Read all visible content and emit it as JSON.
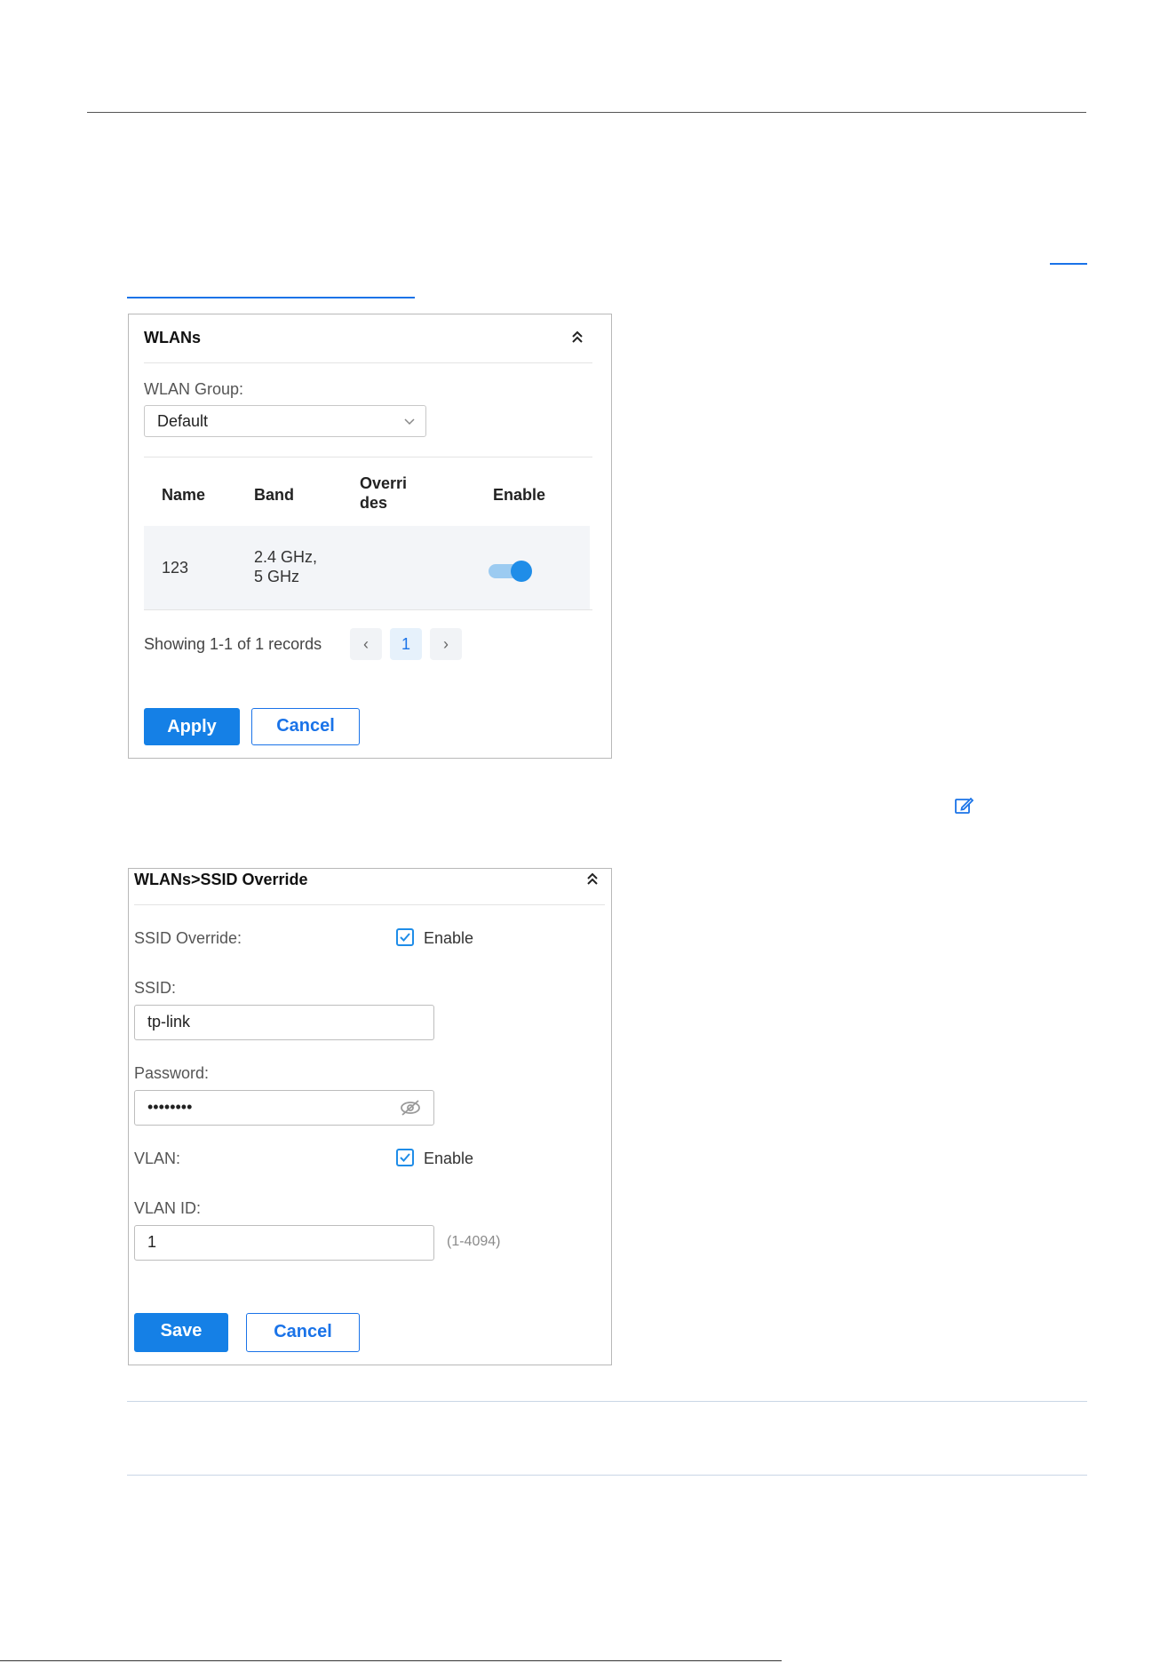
{
  "wlans_panel": {
    "title": "WLANs",
    "group_label": "WLAN Group:",
    "group_value": "Default",
    "columns": {
      "name": "Name",
      "band": "Band",
      "overrides_line1": "Overri",
      "overrides_line2": "des",
      "enable": "Enable"
    },
    "row": {
      "name": "123",
      "band_line1": "2.4 GHz,",
      "band_line2": "5 GHz",
      "enabled": true
    },
    "pagination": {
      "summary": "Showing 1-1 of 1 records",
      "prev": "‹",
      "current": "1",
      "next": "›"
    },
    "apply_label": "Apply",
    "cancel_label": "Cancel"
  },
  "override_panel": {
    "title": "WLANs>SSID Override",
    "ssid_override_label": "SSID Override:",
    "ssid_override_checkbox_label": "Enable",
    "ssid_override_checked": true,
    "ssid_label": "SSID:",
    "ssid_value": "tp-link",
    "password_label": "Password:",
    "password_value": "••••••••",
    "vlan_label": "VLAN:",
    "vlan_checkbox_label": "Enable",
    "vlan_checked": true,
    "vlan_id_label": "VLAN ID:",
    "vlan_id_value": "1",
    "vlan_id_hint": "(1-4094)",
    "save_label": "Save",
    "cancel_label": "Cancel"
  },
  "colors": {
    "accent": "#1580e6",
    "toggle_track": "#9ccbf1",
    "link": "#1a73e8"
  },
  "icons": [
    "collapse-chevrons-icon",
    "dropdown-caret-icon",
    "edit-icon",
    "checkmark-icon",
    "eye-hidden-icon",
    "prev-page-icon",
    "next-page-icon"
  ]
}
